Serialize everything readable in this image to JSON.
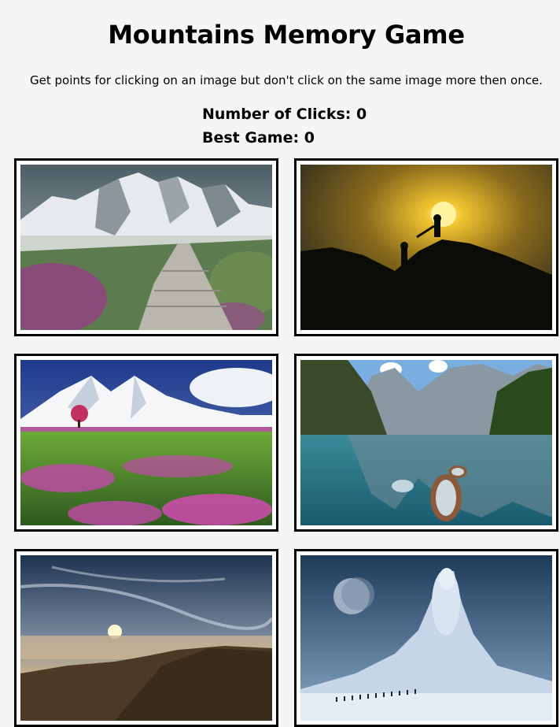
{
  "header": {
    "title": "Mountains Memory Game",
    "instructions": "Get points for clicking on an image but don't click on the same image more then once."
  },
  "score": {
    "clicks_label": "Number of Clicks: 0",
    "best_label": "Best Game: 0"
  },
  "cards": [
    {
      "name": "mountain-path-image",
      "description": "snowy peaks with stone path"
    },
    {
      "name": "climbers-sunset-image",
      "description": "climbers helping at sunset"
    },
    {
      "name": "meadow-mountain-image",
      "description": "pink flower meadow and snowy mountain"
    },
    {
      "name": "lake-boats-image",
      "description": "alpine lake with boats"
    },
    {
      "name": "cloud-sunset-image",
      "description": "sunrise above clouds"
    },
    {
      "name": "ice-giant-image",
      "description": "frozen giant with moon"
    }
  ]
}
